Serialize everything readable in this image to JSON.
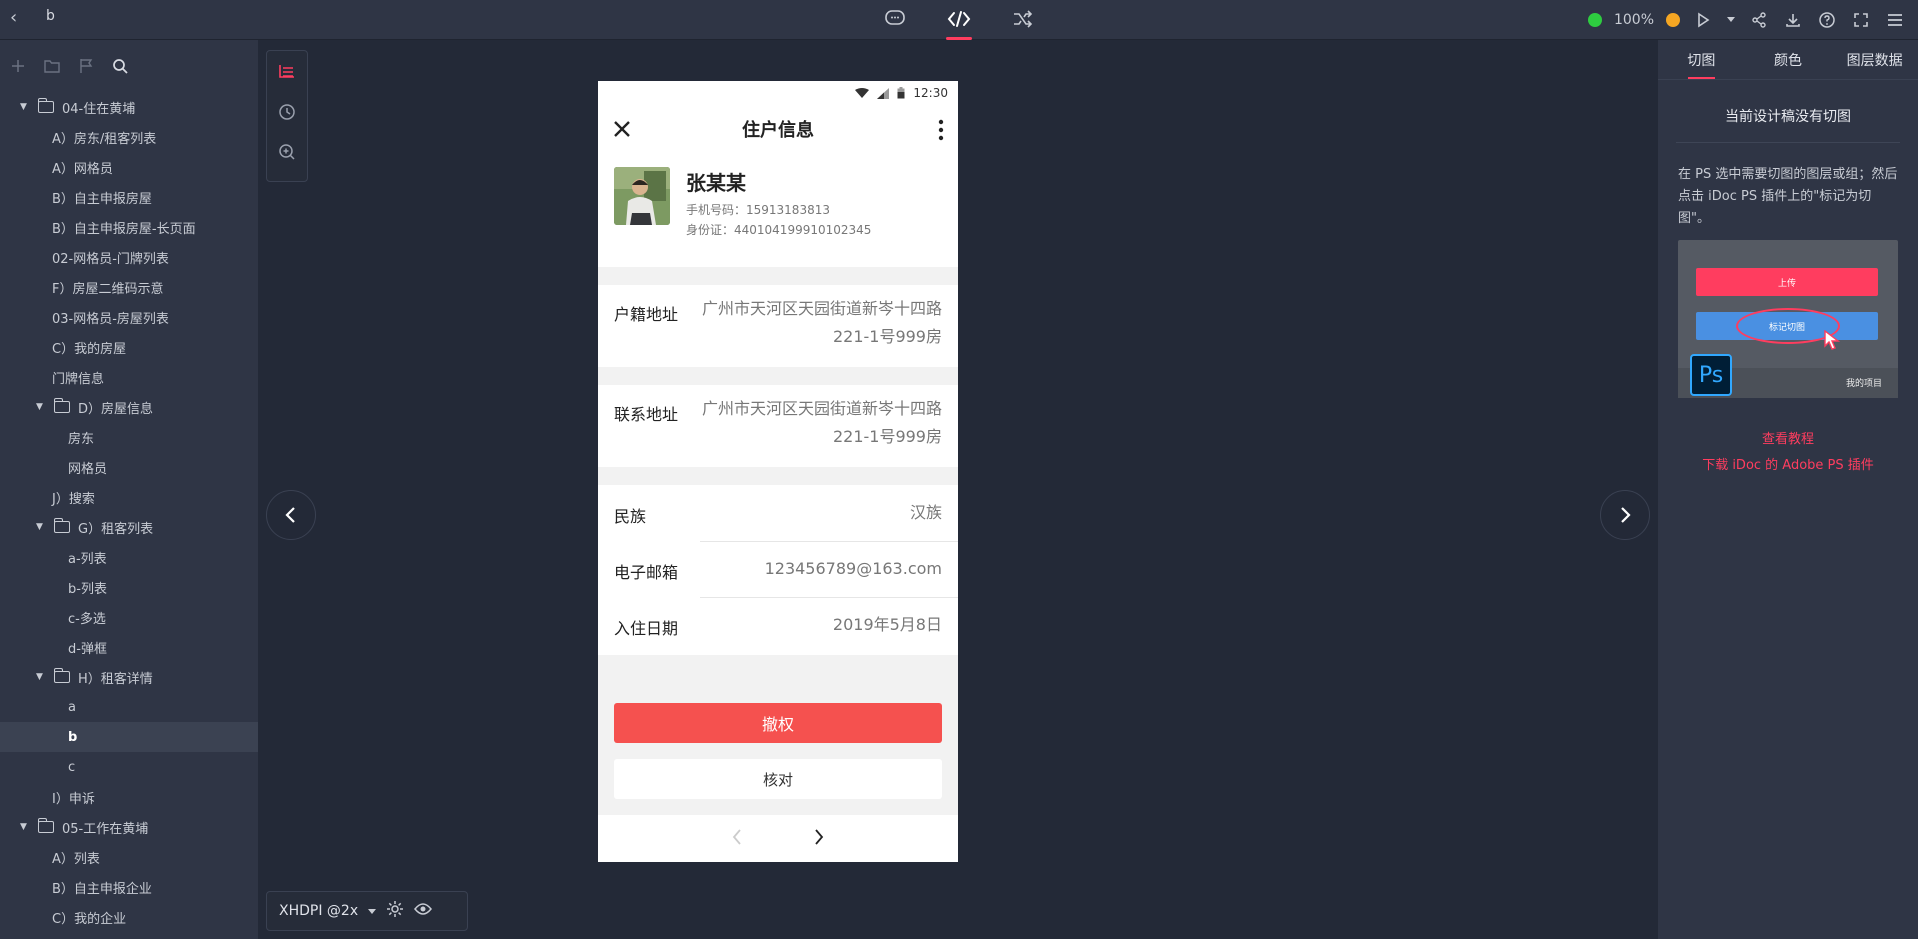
{
  "topbar": {
    "title": "b",
    "zoom": "100%"
  },
  "sidebar": {
    "items": [
      {
        "label": "04-住在黄埔",
        "type": "folder",
        "indent": 0
      },
      {
        "label": "A）房东/租客列表",
        "type": "page",
        "indent": 1
      },
      {
        "label": "A）网格员",
        "type": "page",
        "indent": 1
      },
      {
        "label": "B）自主申报房屋",
        "type": "page",
        "indent": 1
      },
      {
        "label": "B）自主申报房屋-长页面",
        "type": "page",
        "indent": 1
      },
      {
        "label": "02-网格员-门牌列表",
        "type": "page",
        "indent": 1
      },
      {
        "label": "F）房屋二维码示意",
        "type": "page",
        "indent": 1
      },
      {
        "label": "03-网格员-房屋列表",
        "type": "page",
        "indent": 1
      },
      {
        "label": "C）我的房屋",
        "type": "page",
        "indent": 1
      },
      {
        "label": "门牌信息",
        "type": "page",
        "indent": 1
      },
      {
        "label": "D）房屋信息",
        "type": "folder",
        "indent": 1
      },
      {
        "label": "房东",
        "type": "page",
        "indent": 2
      },
      {
        "label": "网格员",
        "type": "page",
        "indent": 2
      },
      {
        "label": "J）搜索",
        "type": "page",
        "indent": 1
      },
      {
        "label": "G）租客列表",
        "type": "folder",
        "indent": 1
      },
      {
        "label": "a-列表",
        "type": "page",
        "indent": 2
      },
      {
        "label": "b-列表",
        "type": "page",
        "indent": 2
      },
      {
        "label": "c-多选",
        "type": "page",
        "indent": 2
      },
      {
        "label": "d-弹框",
        "type": "page",
        "indent": 2
      },
      {
        "label": "H）租客详情",
        "type": "folder",
        "indent": 1
      },
      {
        "label": "a",
        "type": "page",
        "indent": 2
      },
      {
        "label": "b",
        "type": "page",
        "indent": 2,
        "selected": true
      },
      {
        "label": "c",
        "type": "page",
        "indent": 2
      },
      {
        "label": "I）申诉",
        "type": "page",
        "indent": 1
      },
      {
        "label": "05-工作在黄埔",
        "type": "folder",
        "indent": 0
      },
      {
        "label": "A）列表",
        "type": "page",
        "indent": 1
      },
      {
        "label": "B）自主申报企业",
        "type": "page",
        "indent": 1
      },
      {
        "label": "C）我的企业",
        "type": "page",
        "indent": 1
      }
    ]
  },
  "phone": {
    "time": "12:30",
    "header_title": "住户信息",
    "name": "张某某",
    "phone_line": "手机号码：15913183813",
    "id_line": "身份证：440104199910102345",
    "household_label": "户籍地址",
    "household_value_1": "广州市天河区天园街道新岑十四路",
    "household_value_2": "221-1号999房",
    "contact_label": "联系地址",
    "contact_value_1": "广州市天河区天园街道新岑十四路",
    "contact_value_2": "221-1号999房",
    "ethnic_label": "民族",
    "ethnic_value": "汉族",
    "email_label": "电子邮箱",
    "email_value": "123456789@163.com",
    "date_label": "入住日期",
    "date_value": "2019年5月8日",
    "btn_revoke": "撤权",
    "btn_verify": "核对"
  },
  "bottombar": {
    "resolution": "XHDPI @2x"
  },
  "rpanel": {
    "tabs": [
      "切图",
      "颜色",
      "图层数据"
    ],
    "heading": "当前设计稿没有切图",
    "desc": "在 PS 选中需要切图的图层或组；然后点击 iDoc PS 插件上的\"标记为切图\"。",
    "illus_upload": "上传",
    "illus_mark": "标记切图",
    "illus_ps": "Ps",
    "illus_project": "我的项目",
    "link_tutorial": "查看教程",
    "link_download": "下载 iDoc 的 Adobe PS 插件"
  }
}
